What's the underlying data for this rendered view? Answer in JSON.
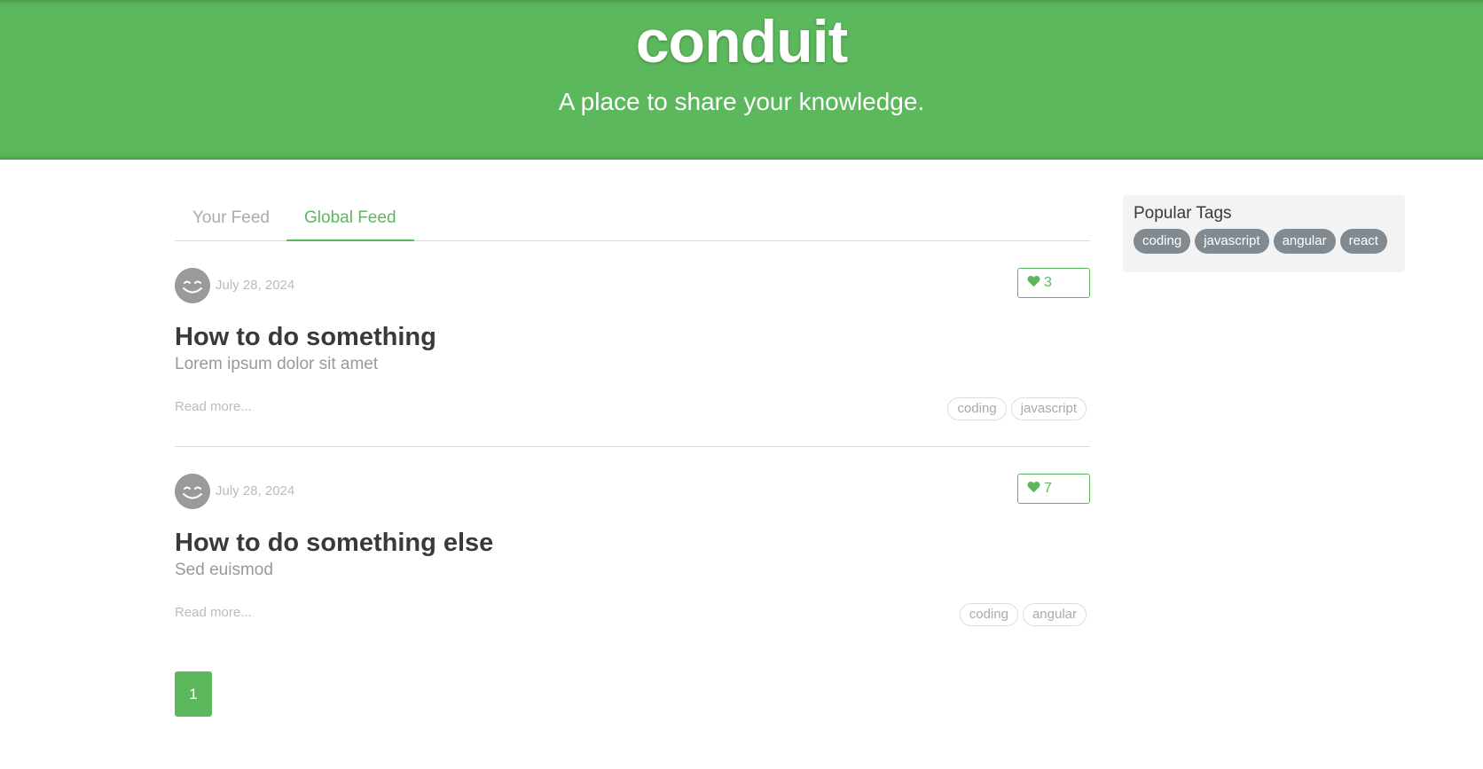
{
  "banner": {
    "logo": "conduit",
    "tagline": "A place to share your knowledge."
  },
  "feed_tabs": [
    {
      "label": "Your Feed",
      "active": false
    },
    {
      "label": "Global Feed",
      "active": true
    }
  ],
  "articles": [
    {
      "date": "July 28, 2024",
      "favorites": "3",
      "title": "How to do something",
      "description": "Lorem ipsum dolor sit amet",
      "read_more": "Read more...",
      "tags": [
        "coding",
        "javascript"
      ]
    },
    {
      "date": "July 28, 2024",
      "favorites": "7",
      "title": "How to do something else",
      "description": "Sed euismod",
      "read_more": "Read more...",
      "tags": [
        "coding",
        "angular"
      ]
    }
  ],
  "pagination": {
    "pages": [
      "1"
    ],
    "current": "1"
  },
  "sidebar": {
    "heading": "Popular Tags",
    "tags": [
      "coding",
      "javascript",
      "angular",
      "react"
    ]
  },
  "colors": {
    "brand": "#5cb85c",
    "tag_pill": "#818a91",
    "muted": "#bbbbbb"
  },
  "icons": {
    "avatar": "smiley-avatar-icon",
    "favorite": "heart-icon"
  }
}
